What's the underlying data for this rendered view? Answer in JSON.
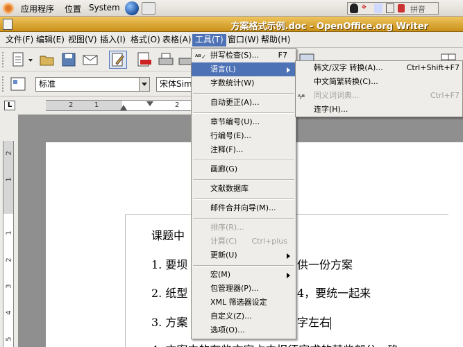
{
  "panel": {
    "applications": "应用程序",
    "places": "位置",
    "system": "System",
    "tray_lang": "拼音"
  },
  "window": {
    "title": "方案格式示例.doc - OpenOffice.org Writer"
  },
  "menubar": {
    "file": "文件(F)",
    "edit": "编辑(E)",
    "view": "视图(V)",
    "insert": "插入(I)",
    "format": "格式(O)",
    "table": "表格(A)",
    "tools": "工具(T)",
    "window": "窗口(W)",
    "help": "帮助(H)"
  },
  "formatting": {
    "style": "标准",
    "font": "宋体Sim"
  },
  "ruler": {
    "h_labels": [
      "2",
      "1",
      "2"
    ],
    "v_labels": [
      "2",
      "1",
      "1",
      "2",
      "3",
      "4",
      "5"
    ]
  },
  "tools_menu": {
    "items": [
      {
        "label": "拼写检查(S)...",
        "shortcut": "F7",
        "enabled": true
      },
      {
        "label": "语言(L)",
        "submenu": true,
        "enabled": true,
        "highlighted": true
      },
      {
        "label": "字数统计(W)",
        "enabled": true
      },
      {
        "label": "自动更正(A)...",
        "enabled": true
      },
      {
        "label": "章节编号(U)...",
        "enabled": true
      },
      {
        "label": "行编号(E)...",
        "enabled": true
      },
      {
        "label": "注释(F)...",
        "enabled": true
      },
      {
        "label": "画廊(G)",
        "enabled": true
      },
      {
        "label": "文献数据库",
        "enabled": true
      },
      {
        "label": "邮件合并向导(M)...",
        "enabled": true
      },
      {
        "label": "排序(R)...",
        "enabled": false
      },
      {
        "label": "计算(C)",
        "shortcut": "Ctrl+plus",
        "enabled": false
      },
      {
        "label": "更新(U)",
        "submenu": true,
        "enabled": true
      },
      {
        "label": "宏(M)",
        "submenu": true,
        "enabled": true
      },
      {
        "label": "包管理器(P)...",
        "enabled": true
      },
      {
        "label": "XML 筛选器设定",
        "enabled": true
      },
      {
        "label": "自定义(Z)...",
        "enabled": true
      },
      {
        "label": "选项(O)...",
        "enabled": true
      }
    ]
  },
  "language_menu": {
    "items": [
      {
        "label": "韩文/汉字 转换(A)...",
        "shortcut": "Ctrl+Shift+F7",
        "enabled": true
      },
      {
        "label": "中文简繁转换(C)...",
        "enabled": true
      },
      {
        "label": "同义词词典...",
        "shortcut": "Ctrl+F7",
        "enabled": false
      },
      {
        "label": "连字(H)...",
        "enabled": true
      }
    ]
  },
  "document": {
    "lines": [
      "课题中",
      "1. 要坝",
      "供一份方案",
      "2. 纸型",
      "4，要统一起来",
      "3. 方案",
      "字左右",
      "4. 方案中的有些文字占中报须字求的某些部分，确"
    ]
  }
}
